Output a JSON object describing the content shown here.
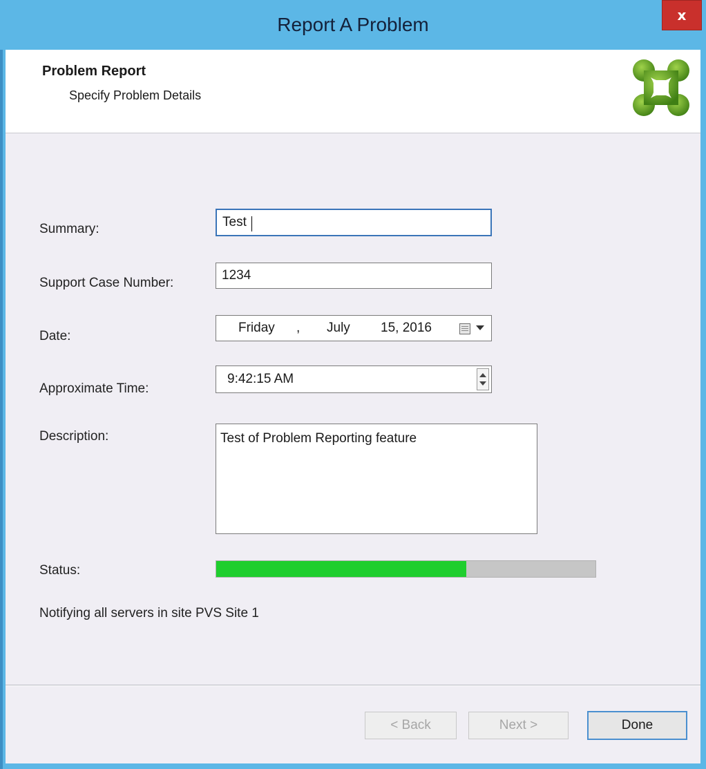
{
  "window": {
    "title": "Report A Problem",
    "close_label": "x"
  },
  "header": {
    "title": "Problem Report",
    "subtitle": "Specify Problem Details",
    "logo_icon": "citrix-logo-icon"
  },
  "form": {
    "summary": {
      "label": "Summary:",
      "value": "Test"
    },
    "case_number": {
      "label": "Support Case Number:",
      "value": "1234"
    },
    "date": {
      "label": "Date:",
      "weekday": "Friday",
      "sep": ",",
      "month": "July",
      "day_year": "15, 2016"
    },
    "time": {
      "label": "Approximate Time:",
      "value": "9:42:15 AM"
    },
    "description": {
      "label": "Description:",
      "value": "Test of Problem Reporting feature"
    },
    "status": {
      "label": "Status:",
      "progress_fraction": 0.66,
      "color": "#1fce2e"
    },
    "status_message": "Notifying all servers in site PVS Site 1"
  },
  "buttons": {
    "back": "< Back",
    "next": "Next >",
    "done": "Done"
  },
  "colors": {
    "titlebar": "#5cb7e6",
    "close": "#c9302c",
    "logo": "#6aaa1e"
  }
}
